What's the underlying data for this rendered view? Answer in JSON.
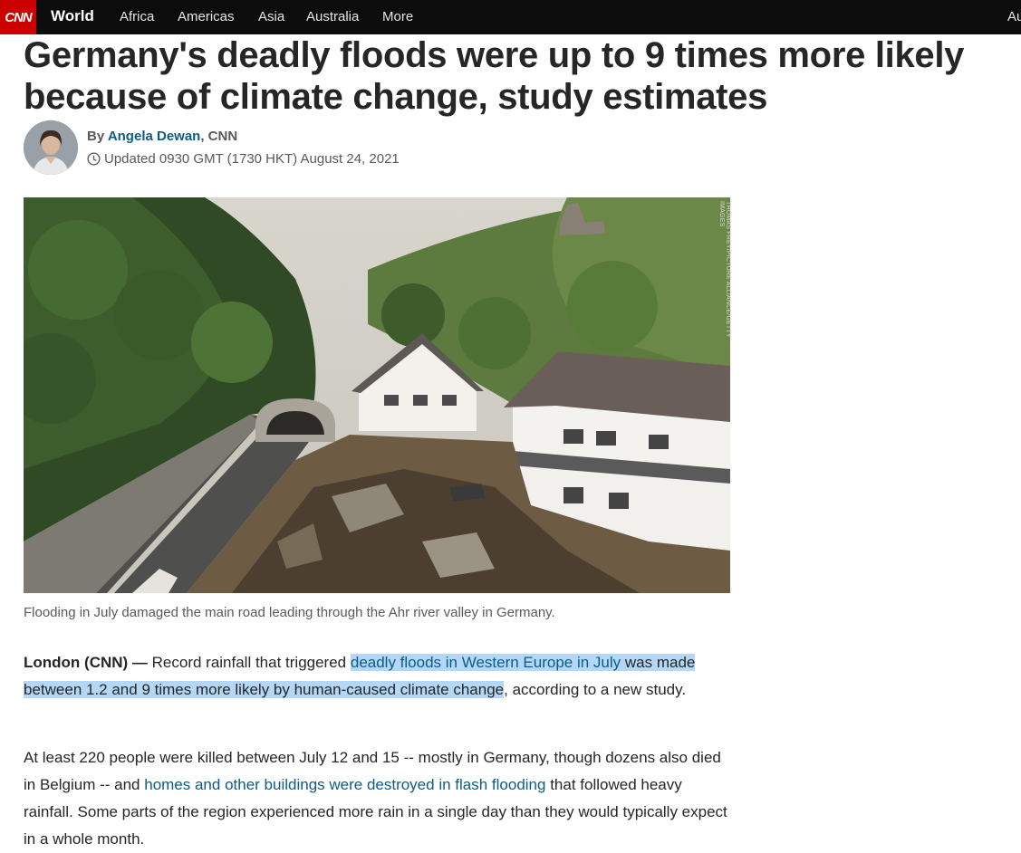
{
  "nav": {
    "logo": "CNN",
    "section": "World",
    "items": [
      "Africa",
      "Americas",
      "Asia",
      "Australia",
      "More"
    ],
    "cut_item": "Au"
  },
  "article": {
    "headline": "Germany's deadly floods were up to 9 times more likely because of climate change, study estimates",
    "byline_prefix": "By",
    "author": "Angela Dewan",
    "outlet": ", CNN",
    "updated": "Updated 0930 GMT (1730 HKT) August 24, 2021",
    "image_credit": "THOMAS FREY/PICTURE ALLIANCE/GETTY IMAGES",
    "caption": "Flooding in July damaged the main road leading through the Ahr river valley in Germany.",
    "p1": {
      "dateline": "London (CNN) —",
      "text1": " Record rainfall that triggered ",
      "link1": "deadly floods in Western Europe in July",
      "text2": " was made between 1.2 and 9 times more likely by human-caused climate change",
      "text3": ", according to a new study."
    },
    "p2": {
      "text1": "At least 220 people were killed between July 12 and 15 -- mostly in Germany, though dozens also died in Belgium -- and ",
      "link1": "homes and other buildings were destroyed in flash flooding",
      "text2": " that followed heavy rainfall. Some parts of the region experienced more rain in a single day than they would typically expect in a whole month."
    }
  },
  "colors": {
    "brand": "#cc0000",
    "nav_bg": "#0c0c0c",
    "link": "#0c5c86",
    "highlight": "#b3d7f5"
  }
}
